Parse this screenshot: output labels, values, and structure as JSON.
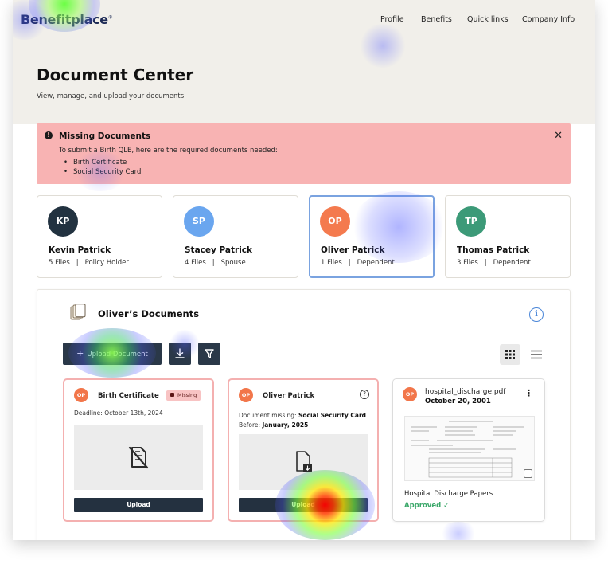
{
  "brand": {
    "logo_text": "Benefitplace",
    "logo_mark": "®"
  },
  "nav": [
    {
      "label": "Profile"
    },
    {
      "label": "Benefits"
    },
    {
      "label": "Quick links"
    },
    {
      "label": "Company Info"
    }
  ],
  "page": {
    "title": "Document Center",
    "subtitle": "View, manage, and upload your documents."
  },
  "alert": {
    "icon": "exclamation-icon",
    "title": "Missing Documents",
    "text": "To submit a Birth QLE, here are the required documents needed:",
    "items": [
      "Birth Certificate",
      "Social Security Card"
    ],
    "close_label": "✕"
  },
  "members": [
    {
      "initials": "KP",
      "name": "Kevin Patrick",
      "files": "5 Files",
      "role": "Policy Holder",
      "color": "#223240"
    },
    {
      "initials": "SP",
      "name": "Stacey Patrick",
      "files": "4 Files",
      "role": "Spouse",
      "color": "#6aa6ef"
    },
    {
      "initials": "OP",
      "name": "Oliver Patrick",
      "files": "1 Files",
      "role": "Dependent",
      "color": "#f47a4e",
      "selected": true
    },
    {
      "initials": "TP",
      "name": "Thomas Patrick",
      "files": "3 Files",
      "role": "Dependent",
      "color": "#3c9a78"
    }
  ],
  "member_sep": "|",
  "documents_panel": {
    "title": "Oliver’s Documents",
    "info_label": "i",
    "upload_label": "Upload Document",
    "upload_plus": "+",
    "view_mode": "grid"
  },
  "cards": [
    {
      "avatar": "OP",
      "title": "Birth Certificate",
      "badge": "Missing",
      "deadline": "Deadline: October 13th, 2024",
      "button": "Upload",
      "status": "missing"
    },
    {
      "avatar": "OP",
      "title": "Oliver Patrick",
      "missing_prefix": "Document missing: ",
      "missing_doc": "Social Security Card",
      "before_prefix": "Before: ",
      "before_date": "January, 2025",
      "help_label": "?",
      "button": "Upload",
      "status": "missing"
    },
    {
      "avatar": "OP",
      "file_name": "hospital_discharge.pdf",
      "date": "October 20, 2001",
      "doc_type": "Hospital Discharge Papers",
      "status_label": "Approved ✓",
      "status": "approved",
      "kebab": "⋮"
    }
  ],
  "colors": {
    "alert_bg": "#f8b3b3",
    "primary_dark": "#2a3848",
    "selected_border": "#7aa3e0",
    "approved": "#3ba86a",
    "hero_bg": "#f1efea"
  }
}
